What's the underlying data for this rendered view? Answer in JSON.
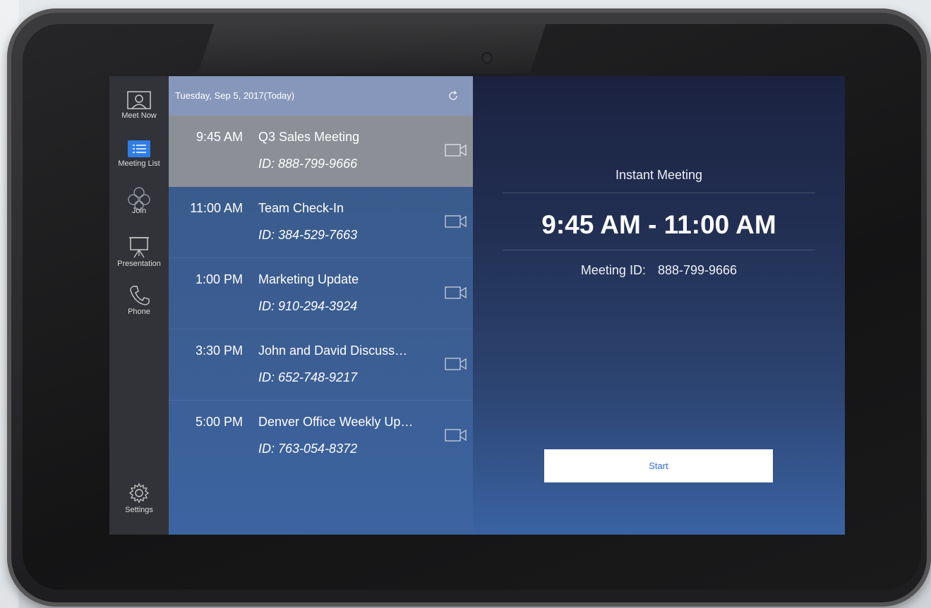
{
  "sidebar": {
    "items": [
      {
        "label": "Meet Now",
        "icon": "person-icon"
      },
      {
        "label": "Meeting List",
        "icon": "list-icon"
      },
      {
        "label": "Join",
        "icon": "join-icon"
      },
      {
        "label": "Presentation",
        "icon": "presentation-icon"
      },
      {
        "label": "Phone",
        "icon": "phone-icon"
      }
    ],
    "settings": {
      "label": "Settings",
      "icon": "gear-icon"
    }
  },
  "meeting_list": {
    "date_header": "Tuesday, Sep 5, 2017(Today)",
    "meetings": [
      {
        "time": "9:45 AM",
        "title": "Q3 Sales Meeting",
        "meeting_id": "ID: 888-799-9666"
      },
      {
        "time": "11:00 AM",
        "title": "Team Check-In",
        "meeting_id": "ID: 384-529-7663"
      },
      {
        "time": "1:00 PM",
        "title": "Marketing Update",
        "meeting_id": "ID: 910-294-3924"
      },
      {
        "time": "3:30 PM",
        "title": "John and David Discuss…",
        "meeting_id": "ID: 652-748-9217"
      },
      {
        "time": "5:00 PM",
        "title": "Denver Office Weekly Up…",
        "meeting_id": "ID: 763-054-8372"
      }
    ]
  },
  "detail": {
    "heading": "Instant Meeting",
    "time_range": "9:45 AM - 11:00 AM",
    "meeting_id_label": "Meeting ID:",
    "meeting_id_value": "888-799-9666",
    "start_label": "Start"
  },
  "colors": {
    "accent": "#2d6fd8",
    "selected_row": "#8c8f96",
    "sidebar": "#323338"
  }
}
